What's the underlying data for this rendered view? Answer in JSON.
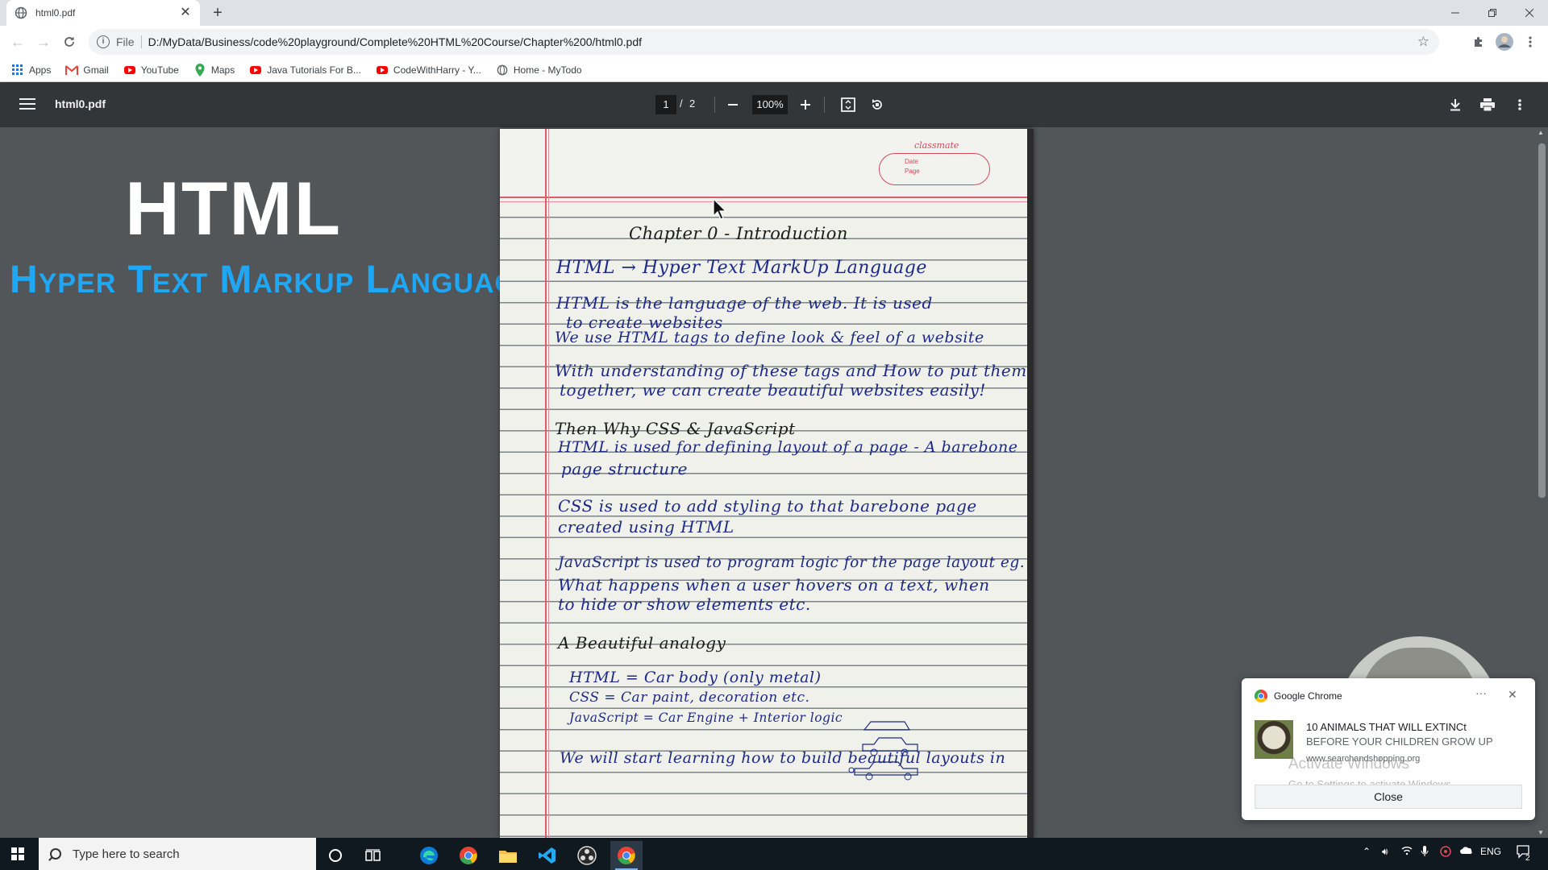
{
  "tab": {
    "title": "html0.pdf"
  },
  "address": {
    "scheme_label": "File",
    "url": "D:/MyData/Business/code%20playground/Complete%20HTML%20Course/Chapter%200/html0.pdf"
  },
  "bookmarks": [
    {
      "label": "Apps",
      "icon": "apps-grid-icon"
    },
    {
      "label": "Gmail",
      "icon": "gmail-icon"
    },
    {
      "label": "YouTube",
      "icon": "youtube-icon"
    },
    {
      "label": "Maps",
      "icon": "maps-icon"
    },
    {
      "label": "Java Tutorials For B...",
      "icon": "youtube-icon"
    },
    {
      "label": "CodeWithHarry - Y...",
      "icon": "youtube-icon"
    },
    {
      "label": "Home - MyTodo",
      "icon": "globe-icon"
    }
  ],
  "pdf": {
    "file_name": "html0.pdf",
    "current_page": "1",
    "separator": "/",
    "total_pages": "2",
    "zoom": "100%"
  },
  "overlay": {
    "title": "HTML",
    "subtitle": "Hyper Text Markup Language"
  },
  "notebook": {
    "stamp_brand": "classmate",
    "stamp_date": "Date",
    "stamp_page": "Page",
    "lines": [
      "Chapter 0 - Introduction",
      "HTML → Hyper Text MarkUp Language",
      "HTML is the language of the web. It is used",
      "to create websites",
      "We use HTML tags to define look & feel of a website",
      "With understanding of these tags and How to put them",
      "together, we can create beautiful websites easily!",
      "Then Why CSS & JavaScript",
      "HTML is used for defining layout of a page - A barebone",
      "page structure",
      "CSS is used to add styling to that barebone page",
      "created using HTML",
      "JavaScript is used to program logic for the page layout eg.",
      "What happens when a user hovers on a text, when",
      "to hide or show elements etc.",
      "A Beautiful analogy",
      "HTML  =  Car body (only metal)",
      "CSS  =  Car paint, decoration etc.",
      "JavaScript = Car Engine + Interior logic",
      "We will start learning how to build beautiful layouts in"
    ]
  },
  "notification": {
    "app": "Google Chrome",
    "headline": "10 ANIMALS THAT WILL EXTINCt",
    "body": "BEFORE YOUR CHILDREN GROW UP",
    "source": "www.searchandshopping.org",
    "close_label": "Close",
    "watermark_title": "Activate Windows",
    "watermark_body": "Go to Settings to activate Windows."
  },
  "taskbar": {
    "search_placeholder": "Type here to search",
    "language": "ENG",
    "notification_count": "2"
  },
  "colors": {
    "subtitle_blue": "#1ea7f5",
    "ink_blue": "#1d2a86",
    "margin_red": "#e05a6c",
    "pdf_toolbar": "#323639"
  }
}
